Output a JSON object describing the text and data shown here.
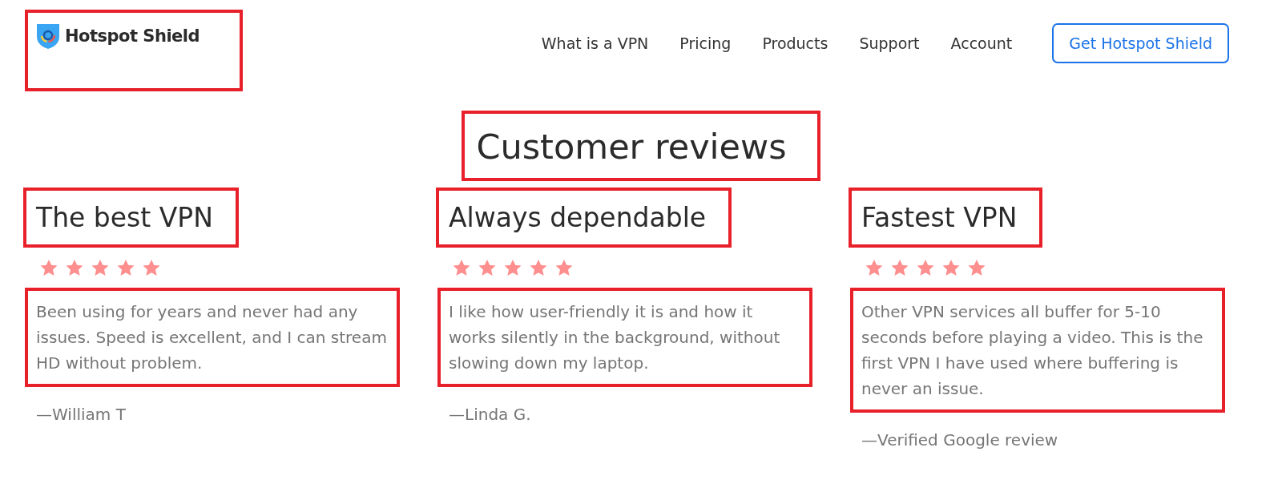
{
  "header": {
    "logo": {
      "text": "Hotspot Shield",
      "highlighted": true
    },
    "nav": [
      "What is a VPN",
      "Pricing",
      "Products",
      "Support",
      "Account"
    ],
    "cta_button": "Get Hotspot Shield"
  },
  "section": {
    "title": "Customer reviews",
    "highlighted": true
  },
  "reviews": [
    {
      "title": "The best VPN",
      "title_highlighted": true,
      "stars": 5,
      "text": "Been using for years and never had any issues. Speed is excellent, and I can stream HD without problem.",
      "text_highlighted": true,
      "author": "—William T"
    },
    {
      "title": "Always dependable",
      "title_highlighted": true,
      "stars": 5,
      "text": "I like how user-friendly it is and how it works silently in the background, without slowing down my laptop.",
      "text_highlighted": true,
      "author": "—Linda G."
    },
    {
      "title": "Fastest VPN",
      "title_highlighted": true,
      "stars": 5,
      "text": "Other VPN services all buffer for 5-10 seconds before playing a video. This is the first VPN I have used where buffering is never an issue.",
      "text_highlighted": true,
      "author": "—Verified Google review"
    }
  ]
}
